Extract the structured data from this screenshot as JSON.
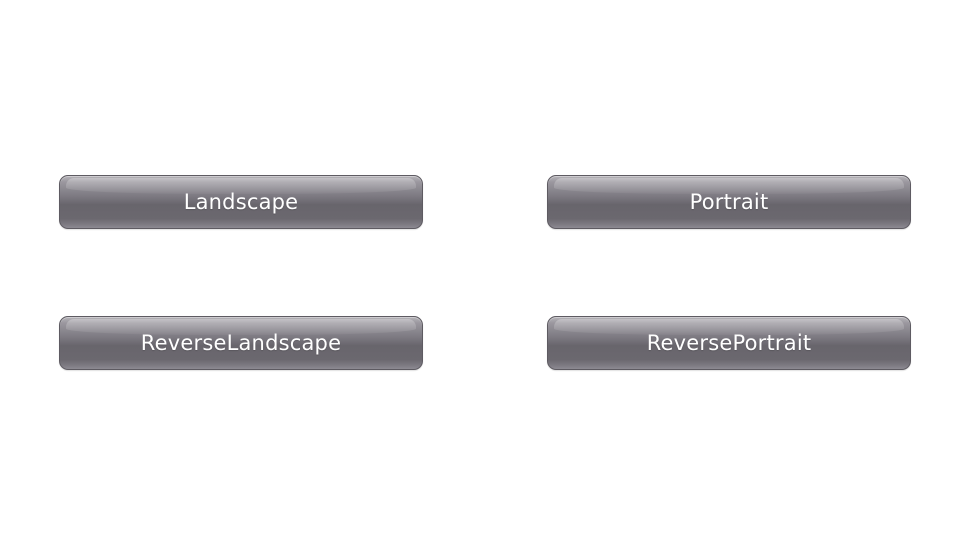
{
  "buttons": {
    "landscape": "Landscape",
    "portrait": "Portrait",
    "reverse_landscape": "ReverseLandscape",
    "reverse_portrait": "ReversePortrait"
  },
  "colors": {
    "background": "#ffffff",
    "button_base": "#6b686f",
    "button_text": "#ffffff"
  }
}
